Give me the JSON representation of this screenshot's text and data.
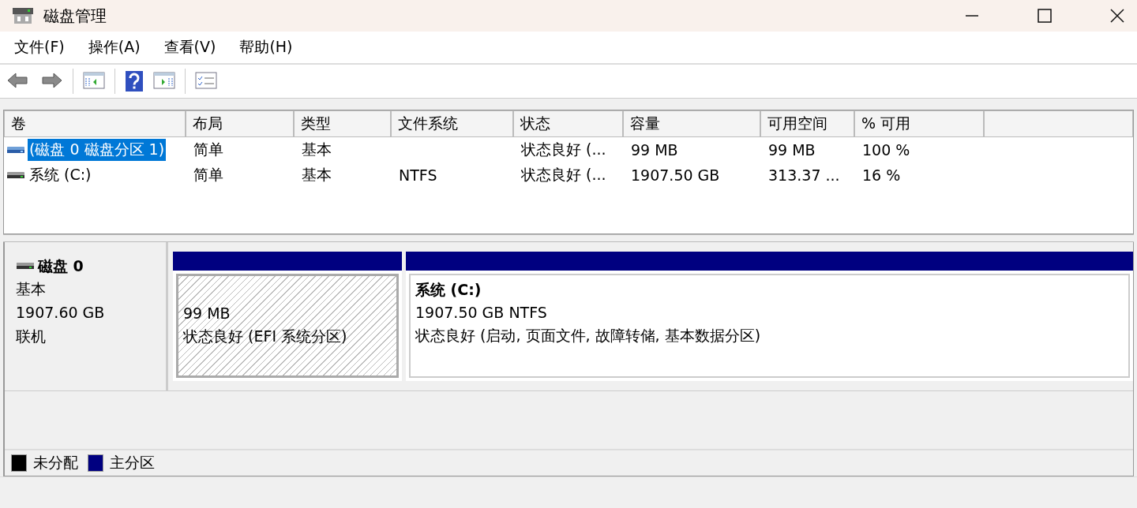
{
  "window": {
    "title": "磁盘管理"
  },
  "menu": [
    "文件(F)",
    "操作(A)",
    "查看(V)",
    "帮助(H)"
  ],
  "toolbar": [
    {
      "kind": "back"
    },
    {
      "kind": "forward"
    },
    {
      "kind": "sep"
    },
    {
      "kind": "pane-left"
    },
    {
      "kind": "sep"
    },
    {
      "kind": "help"
    },
    {
      "kind": "pane-right"
    },
    {
      "kind": "sep"
    },
    {
      "kind": "checklist"
    }
  ],
  "table": {
    "columns": [
      "卷",
      "布局",
      "类型",
      "文件系统",
      "状态",
      "容量",
      "可用空间",
      "% 可用"
    ],
    "rows": [
      {
        "kind": "efi",
        "selected": true,
        "cells": [
          "(磁盘 0 磁盘分区 1)",
          "简单",
          "基本",
          "",
          "状态良好 (...",
          "99 MB",
          "99 MB",
          "100 %"
        ]
      },
      {
        "kind": "system",
        "selected": false,
        "cells": [
          "系统 (C:)",
          "简单",
          "基本",
          "NTFS",
          "状态良好 (...",
          "1907.50 GB",
          "313.37 ...",
          "16 %"
        ]
      }
    ]
  },
  "disk": {
    "name": "磁盘 0",
    "type": "基本",
    "size": "1907.60 GB",
    "status": "联机",
    "partitions": [
      {
        "selected": true,
        "size": "99 MB",
        "status": "状态良好 (EFI 系统分区)",
        "color": "#000080"
      },
      {
        "selected": false,
        "label": "系统  (C:)",
        "size": "1907.50 GB NTFS",
        "status": "状态良好 (启动, 页面文件, 故障转储, 基本数据分区)",
        "color": "#000080"
      }
    ]
  },
  "legend": [
    {
      "label": "未分配",
      "color": "#000000"
    },
    {
      "label": "主分区",
      "color": "#000080"
    }
  ]
}
